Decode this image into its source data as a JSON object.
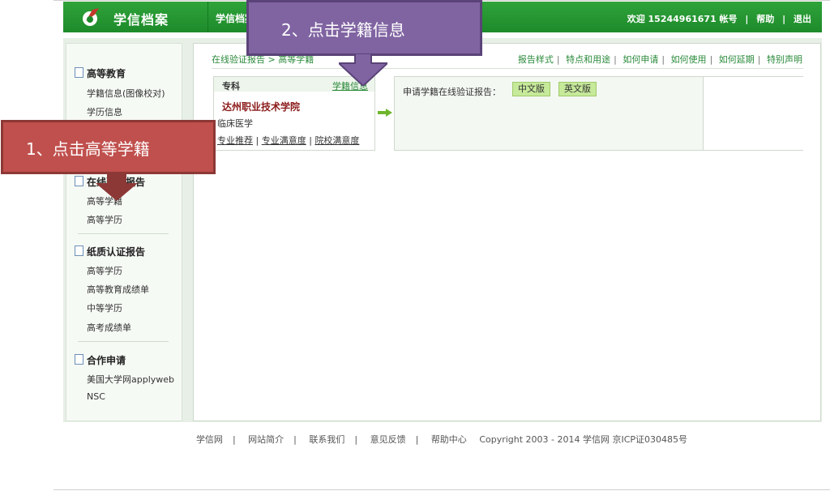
{
  "header": {
    "brand": "学信档案",
    "nav_tab": "学信档案",
    "welcome": "欢迎 15244961671 帐号",
    "help": "帮助",
    "logout": "退出",
    "sep": "|"
  },
  "sidebar": {
    "sections": [
      {
        "title": "高等教育",
        "items": [
          "学籍信息(图像校对)",
          "学历信息"
        ]
      },
      {
        "title": "在线验证报告",
        "items": [
          "高等学籍",
          "高等学历"
        ]
      },
      {
        "title": "纸质认证报告",
        "items": [
          "高等学历",
          "高等教育成绩单",
          "中等学历",
          "高考成绩单"
        ]
      },
      {
        "title": "合作申请",
        "items": [
          "美国大学网applyweb",
          "NSC"
        ]
      }
    ]
  },
  "main": {
    "breadcrumb": "在线验证报告 > 高等学籍",
    "top_links": [
      "报告样式",
      "特点和用途",
      "如何申请",
      "如何使用",
      "如何延期",
      "特别声明"
    ],
    "card": {
      "type": "专科",
      "link": "学籍信息",
      "school": "达州职业技术学院",
      "major": "临床医学",
      "links": [
        "专业推荐",
        "专业满意度",
        "院校满意度"
      ]
    },
    "apply_label": "申请学籍在线验证报告：",
    "btn_cn": "中文版",
    "btn_en": "英文版"
  },
  "footer": {
    "items": [
      "学信网",
      "网站简介",
      "联系我们",
      "意见反馈",
      "帮助中心"
    ],
    "copyright": "Copyright 2003 - 2014  学信网  京ICP证030485号"
  },
  "callouts": {
    "one": "1、点击高等学籍",
    "two": "2、点击学籍信息"
  },
  "colors": {
    "header_green": "#1d8a2a",
    "callout1": "#c0504d",
    "callout2": "#8064a2",
    "button": "#c6e99a"
  }
}
